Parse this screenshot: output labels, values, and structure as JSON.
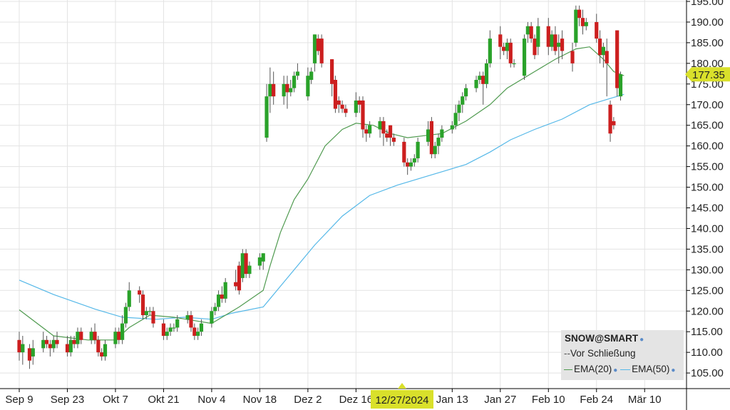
{
  "chart_data": {
    "type": "candlestick",
    "symbol_label": "SNOW@SMART",
    "legend": {
      "prev_close": "Vor Schließung",
      "ema20": "EMA(20)",
      "ema50": "EMA(50)"
    },
    "current_price_label": "177.35",
    "cursor_date_label": "12/27/2024",
    "y_ticks": [
      "195.00",
      "190.00",
      "185.00",
      "180.00",
      "175.00",
      "170.00",
      "165.00",
      "160.00",
      "155.00",
      "150.00",
      "145.00",
      "140.00",
      "135.00",
      "130.00",
      "125.00",
      "120.00",
      "115.00",
      "110.00",
      "105.00"
    ],
    "x_ticks": [
      {
        "label": "Sep 9",
        "day": 0
      },
      {
        "label": "Sep 23",
        "day": 14
      },
      {
        "label": "Okt 7",
        "day": 28
      },
      {
        "label": "Okt 21",
        "day": 42
      },
      {
        "label": "Nov 4",
        "day": 56
      },
      {
        "label": "Nov 18",
        "day": 70
      },
      {
        "label": "Dez 2",
        "day": 84
      },
      {
        "label": "Dez 16",
        "day": 98
      },
      {
        "label": "Jan 13",
        "day": 126
      },
      {
        "label": "Jan 27",
        "day": 140
      },
      {
        "label": "Feb 10",
        "day": 154
      },
      {
        "label": "Feb 24",
        "day": 168
      },
      {
        "label": "Mär 10",
        "day": 182
      }
    ],
    "candles": [
      [
        0,
        113,
        110,
        115,
        108
      ],
      [
        1,
        110,
        112,
        114,
        107
      ],
      [
        3,
        111,
        108,
        112,
        106
      ],
      [
        4,
        109,
        111,
        113,
        107
      ],
      [
        7,
        111,
        113,
        115,
        110
      ],
      [
        8,
        113,
        112,
        114,
        111
      ],
      [
        9,
        112,
        111,
        113,
        109
      ],
      [
        10,
        111,
        113,
        114,
        110
      ],
      [
        11,
        113,
        112,
        115,
        111
      ],
      [
        14,
        112,
        110,
        114,
        109
      ],
      [
        15,
        110,
        113,
        114,
        109
      ],
      [
        16,
        113,
        112,
        114,
        111
      ],
      [
        17,
        112,
        115,
        116,
        111
      ],
      [
        18,
        115,
        113,
        116,
        112
      ],
      [
        21,
        113,
        115,
        116,
        112
      ],
      [
        22,
        115,
        113,
        117,
        112
      ],
      [
        23,
        113,
        110,
        114,
        109
      ],
      [
        24,
        110,
        109,
        111,
        108
      ],
      [
        25,
        109,
        112,
        113,
        108
      ],
      [
        28,
        112,
        115,
        116,
        111
      ],
      [
        29,
        115,
        113,
        116,
        112
      ],
      [
        30,
        113,
        117,
        119,
        112
      ],
      [
        31,
        117,
        121,
        122,
        116
      ],
      [
        32,
        121,
        125,
        127,
        120
      ],
      [
        35,
        125,
        124,
        126,
        122
      ],
      [
        36,
        124,
        119,
        125,
        118
      ],
      [
        37,
        119,
        120,
        121,
        118
      ],
      [
        38,
        120,
        120,
        121,
        119
      ],
      [
        39,
        120,
        117,
        121,
        116
      ],
      [
        42,
        117,
        114,
        118,
        113
      ],
      [
        43,
        114,
        115,
        116,
        113
      ],
      [
        44,
        115,
        116,
        117,
        114
      ],
      [
        45,
        116,
        116,
        117,
        115
      ],
      [
        46,
        116,
        118,
        119,
        115
      ],
      [
        49,
        118,
        119,
        120,
        117
      ],
      [
        50,
        119,
        116,
        120,
        115
      ],
      [
        51,
        116,
        114,
        117,
        113
      ],
      [
        52,
        114,
        115,
        116,
        113
      ],
      [
        53,
        115,
        117,
        118,
        114
      ],
      [
        56,
        117,
        120,
        121,
        116
      ],
      [
        57,
        120,
        121,
        122,
        119
      ],
      [
        58,
        121,
        124,
        125,
        120
      ],
      [
        59,
        124,
        123,
        126,
        122
      ],
      [
        60,
        123,
        127,
        128,
        122
      ],
      [
        63,
        127,
        126,
        130,
        125
      ],
      [
        64,
        131,
        125,
        132,
        124
      ],
      [
        65,
        128,
        134,
        135,
        127
      ],
      [
        66,
        134,
        129,
        135,
        128
      ],
      [
        67,
        129,
        131,
        132,
        128
      ],
      [
        70,
        131,
        133,
        134,
        130
      ],
      [
        71,
        132,
        134,
        134,
        130
      ],
      [
        72,
        162,
        172,
        175,
        161
      ],
      [
        73,
        172,
        175,
        179,
        168
      ],
      [
        74,
        175,
        172,
        178,
        170
      ],
      [
        77,
        172,
        175,
        177,
        170
      ],
      [
        78,
        175,
        173,
        177,
        169
      ],
      [
        79,
        173,
        174,
        176,
        172
      ],
      [
        80,
        174,
        177,
        178,
        173
      ],
      [
        81,
        177,
        178,
        180,
        176
      ],
      [
        84,
        172,
        177,
        179,
        171
      ],
      [
        85,
        176,
        178,
        179,
        175
      ],
      [
        86,
        180,
        187,
        187,
        178
      ],
      [
        87,
        186,
        183,
        187,
        182
      ],
      [
        88,
        186,
        180,
        187,
        179
      ],
      [
        91,
        181,
        175,
        181,
        172
      ],
      [
        92,
        176,
        169,
        177,
        168
      ],
      [
        93,
        171,
        170,
        172,
        168
      ],
      [
        94,
        170,
        169,
        171,
        168
      ],
      [
        95,
        169,
        168,
        170,
        167
      ],
      [
        98,
        168,
        171,
        173,
        167
      ],
      [
        99,
        171,
        170,
        172,
        168
      ],
      [
        100,
        171,
        164,
        172,
        162
      ],
      [
        101,
        164,
        163,
        165,
        161
      ],
      [
        102,
        163,
        165,
        166,
        162
      ],
      [
        105,
        164,
        166,
        167,
        162
      ],
      [
        106,
        166,
        163,
        167,
        160
      ],
      [
        107,
        163,
        162,
        164,
        161
      ],
      [
        108,
        165,
        162,
        165,
        160
      ],
      [
        109,
        162,
        161,
        163,
        160
      ],
      [
        112,
        161,
        156,
        162,
        155
      ],
      [
        113,
        156,
        155,
        157,
        153
      ],
      [
        114,
        155,
        156,
        157,
        154
      ],
      [
        115,
        156,
        157,
        158,
        155
      ],
      [
        116,
        157,
        161,
        162,
        156
      ],
      [
        119,
        161,
        164,
        166,
        160
      ],
      [
        120,
        166,
        158,
        167,
        157
      ],
      [
        121,
        158,
        160,
        161,
        157
      ],
      [
        122,
        160,
        162,
        163,
        158
      ],
      [
        123,
        162,
        164,
        165,
        161
      ],
      [
        126,
        164,
        165,
        166,
        163
      ],
      [
        127,
        165,
        168,
        170,
        164
      ],
      [
        128,
        168,
        170,
        171,
        166
      ],
      [
        129,
        170,
        172,
        173,
        168
      ],
      [
        130,
        172,
        174,
        175,
        171
      ],
      [
        133,
        174,
        176,
        177,
        173
      ],
      [
        134,
        176,
        177,
        178,
        175
      ],
      [
        135,
        177,
        175,
        178,
        170
      ],
      [
        136,
        175,
        180,
        181,
        174
      ],
      [
        137,
        180,
        186,
        188,
        179
      ],
      [
        140,
        187,
        184,
        189,
        181
      ],
      [
        141,
        184,
        183,
        185,
        182
      ],
      [
        142,
        183,
        185,
        186,
        181
      ],
      [
        143,
        185,
        180,
        186,
        179
      ],
      [
        144,
        180,
        180,
        181,
        179
      ],
      [
        147,
        177,
        186,
        187,
        176
      ],
      [
        148,
        187,
        189,
        190,
        185
      ],
      [
        149,
        189,
        186,
        190,
        185
      ],
      [
        150,
        186,
        182,
        187,
        181
      ],
      [
        151,
        184,
        189,
        191,
        182
      ],
      [
        154,
        189,
        184,
        191,
        182
      ],
      [
        155,
        184,
        187,
        188,
        183
      ],
      [
        156,
        187,
        183,
        189,
        182
      ],
      [
        157,
        184,
        185,
        187,
        180
      ],
      [
        158,
        186,
        183,
        188,
        181
      ],
      [
        161,
        183,
        180,
        185,
        178
      ],
      [
        162,
        185,
        193,
        194,
        184
      ],
      [
        163,
        193,
        191,
        194,
        189
      ],
      [
        164,
        191,
        189,
        193,
        187
      ],
      [
        165,
        189,
        190,
        191,
        188
      ],
      [
        168,
        190,
        186,
        192,
        185
      ],
      [
        169,
        186,
        182,
        188,
        180
      ],
      [
        170,
        182,
        184,
        185,
        179
      ],
      [
        171,
        183,
        180,
        186,
        172
      ],
      [
        172,
        170,
        163,
        171,
        161
      ],
      [
        173,
        166,
        165,
        167,
        164
      ],
      [
        174,
        188,
        174,
        188,
        172
      ],
      [
        175,
        172,
        177.35,
        178,
        171
      ]
    ],
    "ema20": [
      [
        0,
        120.3
      ],
      [
        10,
        114
      ],
      [
        20,
        113
      ],
      [
        28,
        113
      ],
      [
        32,
        116
      ],
      [
        38,
        119
      ],
      [
        45,
        118.5
      ],
      [
        56,
        117
      ],
      [
        64,
        121
      ],
      [
        71,
        125
      ],
      [
        73,
        131
      ],
      [
        76,
        139
      ],
      [
        80,
        147
      ],
      [
        84,
        152
      ],
      [
        89,
        160
      ],
      [
        94,
        164
      ],
      [
        98,
        165.5
      ],
      [
        103,
        165
      ],
      [
        108,
        163
      ],
      [
        113,
        162
      ],
      [
        118,
        162.5
      ],
      [
        123,
        163
      ],
      [
        130,
        166
      ],
      [
        137,
        170
      ],
      [
        142,
        174
      ],
      [
        150,
        178
      ],
      [
        156,
        181
      ],
      [
        162,
        183.5
      ],
      [
        166,
        184
      ],
      [
        170,
        181
      ],
      [
        173,
        178
      ],
      [
        176,
        177
      ]
    ],
    "ema50": [
      [
        0,
        127.5
      ],
      [
        10,
        124
      ],
      [
        22,
        120.5
      ],
      [
        30,
        118.5
      ],
      [
        40,
        118
      ],
      [
        48,
        118.5
      ],
      [
        56,
        118
      ],
      [
        62,
        119.5
      ],
      [
        71,
        121
      ],
      [
        78,
        128
      ],
      [
        86,
        136
      ],
      [
        94,
        143
      ],
      [
        102,
        148
      ],
      [
        110,
        150.5
      ],
      [
        118,
        152.5
      ],
      [
        124,
        154
      ],
      [
        130,
        155.5
      ],
      [
        137,
        158.5
      ],
      [
        143,
        161.5
      ],
      [
        150,
        164
      ],
      [
        158,
        166.5
      ],
      [
        166,
        170
      ],
      [
        172,
        171.5
      ],
      [
        176,
        172.5
      ]
    ],
    "ylim": [
      100,
      195.5
    ],
    "colors": {
      "up": "#2aa22a",
      "down": "#cc1f1f",
      "ema20": "#4f9a4f",
      "ema50": "#55b8e8",
      "highlight": "#d9e02b"
    }
  }
}
